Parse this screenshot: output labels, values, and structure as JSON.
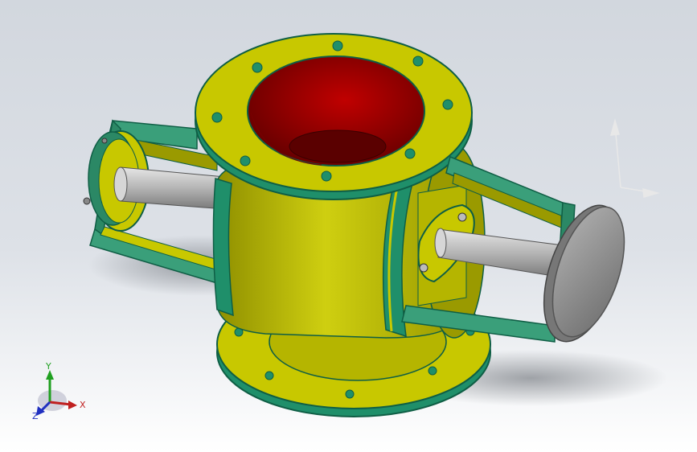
{
  "viewport": {
    "background_top": "#d2d7de",
    "background_bottom": "#ffffff"
  },
  "model": {
    "colors": {
      "body_yellow": "#c8c800",
      "body_yellow_dark": "#9a9a00",
      "edge_green": "#1f8f6a",
      "edge_green_dark": "#0f5e45",
      "interior_red": "#9b0000",
      "interior_red_dark": "#5a0000",
      "shaft_gray": "#a8a8a8",
      "disc_gray": "#8a8a8a"
    },
    "icons": [
      "triad-icon",
      "reference-triad-icon"
    ]
  },
  "triad": {
    "x_label": "X",
    "y_label": "Y",
    "z_label": "Z",
    "x_color": "#c02020",
    "y_color": "#20a020",
    "z_color": "#2030c0"
  }
}
